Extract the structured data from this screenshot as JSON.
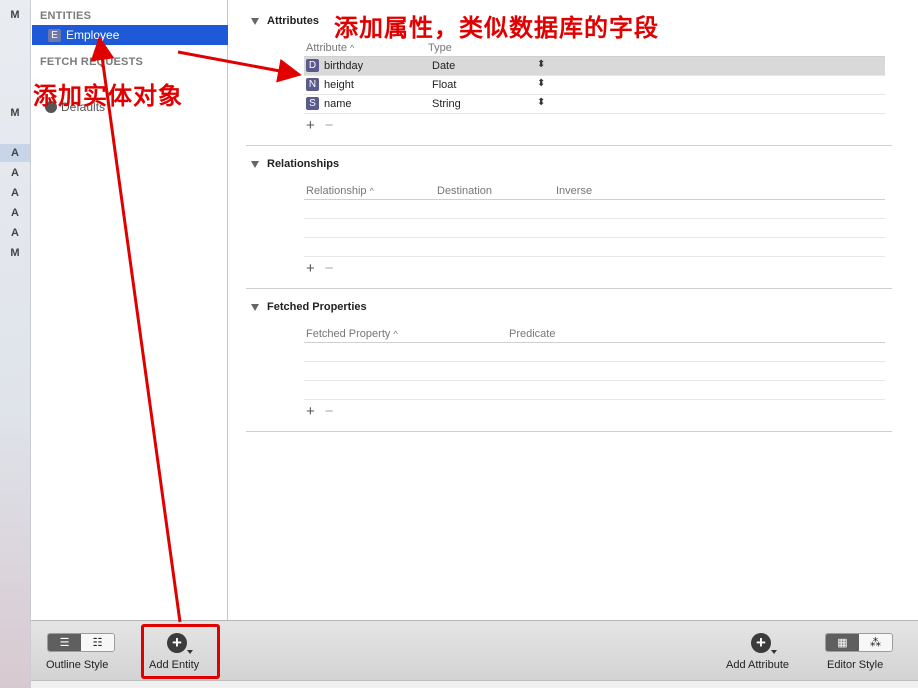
{
  "strip": {
    "items": [
      {
        "label": "M",
        "selected": false
      },
      {
        "label": "M",
        "selected": false
      },
      {
        "label": "A",
        "selected": true
      },
      {
        "label": "A",
        "selected": false
      },
      {
        "label": "A",
        "selected": false
      },
      {
        "label": "A",
        "selected": false
      },
      {
        "label": "A",
        "selected": false
      },
      {
        "label": "M",
        "selected": false
      }
    ]
  },
  "sidebar": {
    "entities_header": "ENTITIES",
    "entity": {
      "badge": "E",
      "name": "Employee"
    },
    "fetch_header": "FETCH REQUESTS",
    "fetch_item": "Defaults"
  },
  "attributes": {
    "title": "Attributes",
    "col_attribute": "Attribute",
    "col_type": "Type",
    "rows": [
      {
        "badge": "D",
        "name": "birthday",
        "type": "Date",
        "selected": true
      },
      {
        "badge": "N",
        "name": "height",
        "type": "Float",
        "selected": false
      },
      {
        "badge": "S",
        "name": "name",
        "type": "String",
        "selected": false
      }
    ]
  },
  "relationships": {
    "title": "Relationships",
    "col_relationship": "Relationship",
    "col_destination": "Destination",
    "col_inverse": "Inverse"
  },
  "fetched_properties": {
    "title": "Fetched Properties",
    "col_property": "Fetched Property",
    "col_predicate": "Predicate"
  },
  "controls": {
    "add": "+",
    "remove": "−",
    "sort_arrow": "^",
    "stepper": "⌃⌄"
  },
  "toolbar": {
    "outline_style": "Outline Style",
    "add_entity": "Add Entity",
    "add_attribute": "Add Attribute",
    "editor_style": "Editor Style"
  },
  "annotations": {
    "attr_note": "添加属性，类似数据库的字段",
    "entity_note": "添加实体对象",
    "color": "#e00000"
  }
}
